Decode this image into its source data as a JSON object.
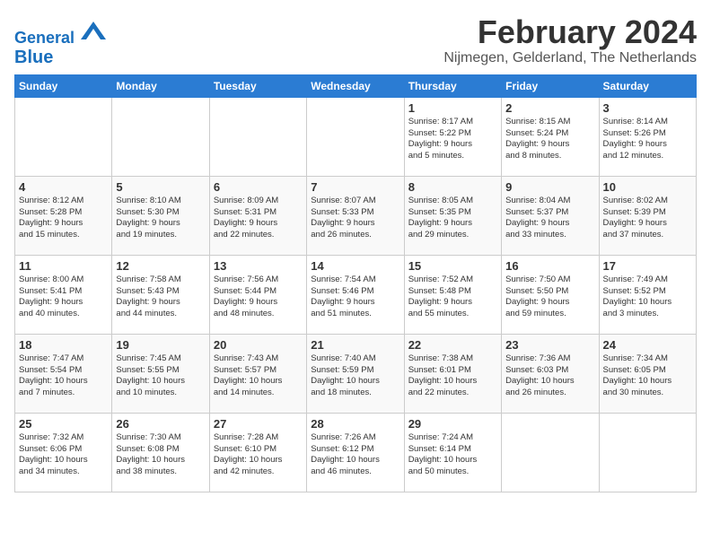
{
  "header": {
    "logo_line1": "General",
    "logo_line2": "Blue",
    "title": "February 2024",
    "subtitle": "Nijmegen, Gelderland, The Netherlands"
  },
  "days_of_week": [
    "Sunday",
    "Monday",
    "Tuesday",
    "Wednesday",
    "Thursday",
    "Friday",
    "Saturday"
  ],
  "weeks": [
    [
      {
        "day": "",
        "info": ""
      },
      {
        "day": "",
        "info": ""
      },
      {
        "day": "",
        "info": ""
      },
      {
        "day": "",
        "info": ""
      },
      {
        "day": "1",
        "info": "Sunrise: 8:17 AM\nSunset: 5:22 PM\nDaylight: 9 hours\nand 5 minutes."
      },
      {
        "day": "2",
        "info": "Sunrise: 8:15 AM\nSunset: 5:24 PM\nDaylight: 9 hours\nand 8 minutes."
      },
      {
        "day": "3",
        "info": "Sunrise: 8:14 AM\nSunset: 5:26 PM\nDaylight: 9 hours\nand 12 minutes."
      }
    ],
    [
      {
        "day": "4",
        "info": "Sunrise: 8:12 AM\nSunset: 5:28 PM\nDaylight: 9 hours\nand 15 minutes."
      },
      {
        "day": "5",
        "info": "Sunrise: 8:10 AM\nSunset: 5:30 PM\nDaylight: 9 hours\nand 19 minutes."
      },
      {
        "day": "6",
        "info": "Sunrise: 8:09 AM\nSunset: 5:31 PM\nDaylight: 9 hours\nand 22 minutes."
      },
      {
        "day": "7",
        "info": "Sunrise: 8:07 AM\nSunset: 5:33 PM\nDaylight: 9 hours\nand 26 minutes."
      },
      {
        "day": "8",
        "info": "Sunrise: 8:05 AM\nSunset: 5:35 PM\nDaylight: 9 hours\nand 29 minutes."
      },
      {
        "day": "9",
        "info": "Sunrise: 8:04 AM\nSunset: 5:37 PM\nDaylight: 9 hours\nand 33 minutes."
      },
      {
        "day": "10",
        "info": "Sunrise: 8:02 AM\nSunset: 5:39 PM\nDaylight: 9 hours\nand 37 minutes."
      }
    ],
    [
      {
        "day": "11",
        "info": "Sunrise: 8:00 AM\nSunset: 5:41 PM\nDaylight: 9 hours\nand 40 minutes."
      },
      {
        "day": "12",
        "info": "Sunrise: 7:58 AM\nSunset: 5:43 PM\nDaylight: 9 hours\nand 44 minutes."
      },
      {
        "day": "13",
        "info": "Sunrise: 7:56 AM\nSunset: 5:44 PM\nDaylight: 9 hours\nand 48 minutes."
      },
      {
        "day": "14",
        "info": "Sunrise: 7:54 AM\nSunset: 5:46 PM\nDaylight: 9 hours\nand 51 minutes."
      },
      {
        "day": "15",
        "info": "Sunrise: 7:52 AM\nSunset: 5:48 PM\nDaylight: 9 hours\nand 55 minutes."
      },
      {
        "day": "16",
        "info": "Sunrise: 7:50 AM\nSunset: 5:50 PM\nDaylight: 9 hours\nand 59 minutes."
      },
      {
        "day": "17",
        "info": "Sunrise: 7:49 AM\nSunset: 5:52 PM\nDaylight: 10 hours\nand 3 minutes."
      }
    ],
    [
      {
        "day": "18",
        "info": "Sunrise: 7:47 AM\nSunset: 5:54 PM\nDaylight: 10 hours\nand 7 minutes."
      },
      {
        "day": "19",
        "info": "Sunrise: 7:45 AM\nSunset: 5:55 PM\nDaylight: 10 hours\nand 10 minutes."
      },
      {
        "day": "20",
        "info": "Sunrise: 7:43 AM\nSunset: 5:57 PM\nDaylight: 10 hours\nand 14 minutes."
      },
      {
        "day": "21",
        "info": "Sunrise: 7:40 AM\nSunset: 5:59 PM\nDaylight: 10 hours\nand 18 minutes."
      },
      {
        "day": "22",
        "info": "Sunrise: 7:38 AM\nSunset: 6:01 PM\nDaylight: 10 hours\nand 22 minutes."
      },
      {
        "day": "23",
        "info": "Sunrise: 7:36 AM\nSunset: 6:03 PM\nDaylight: 10 hours\nand 26 minutes."
      },
      {
        "day": "24",
        "info": "Sunrise: 7:34 AM\nSunset: 6:05 PM\nDaylight: 10 hours\nand 30 minutes."
      }
    ],
    [
      {
        "day": "25",
        "info": "Sunrise: 7:32 AM\nSunset: 6:06 PM\nDaylight: 10 hours\nand 34 minutes."
      },
      {
        "day": "26",
        "info": "Sunrise: 7:30 AM\nSunset: 6:08 PM\nDaylight: 10 hours\nand 38 minutes."
      },
      {
        "day": "27",
        "info": "Sunrise: 7:28 AM\nSunset: 6:10 PM\nDaylight: 10 hours\nand 42 minutes."
      },
      {
        "day": "28",
        "info": "Sunrise: 7:26 AM\nSunset: 6:12 PM\nDaylight: 10 hours\nand 46 minutes."
      },
      {
        "day": "29",
        "info": "Sunrise: 7:24 AM\nSunset: 6:14 PM\nDaylight: 10 hours\nand 50 minutes."
      },
      {
        "day": "",
        "info": ""
      },
      {
        "day": "",
        "info": ""
      }
    ]
  ]
}
